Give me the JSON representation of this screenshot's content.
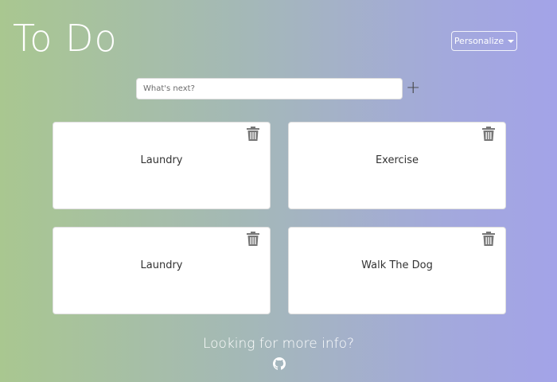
{
  "header": {
    "title": "To Do",
    "personalize_label": "Personalize"
  },
  "new_task": {
    "placeholder": "What's next?",
    "add_symbol": "+"
  },
  "tasks": [
    {
      "label": "Laundry"
    },
    {
      "label": "Exercise"
    },
    {
      "label": "Laundry"
    },
    {
      "label": "Walk The Dog"
    }
  ],
  "footer": {
    "info_text": "Looking for more info?",
    "icon": "github-icon"
  },
  "colors": {
    "gradient_start": "#a9c790",
    "gradient_end": "#a3a3e8",
    "icon_gray": "#777777"
  }
}
